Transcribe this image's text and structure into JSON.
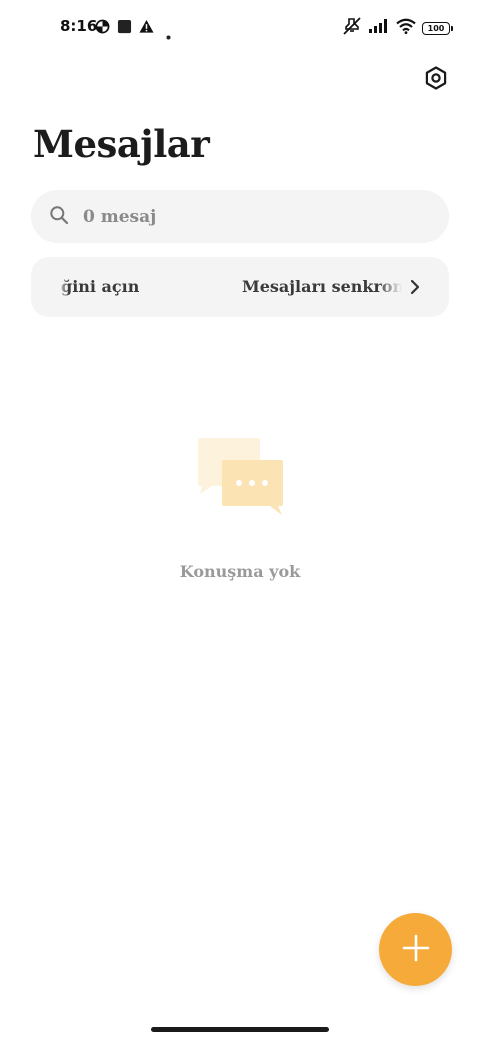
{
  "status_bar": {
    "time": "8:16",
    "battery": "100",
    "icons": [
      "data-saver-icon",
      "app-notification-icon",
      "warning-icon",
      "dot-icon",
      "mute-icon",
      "signal-icon",
      "wifi-icon",
      "battery-icon"
    ]
  },
  "header": {
    "title": "Mesajlar",
    "settings_icon": "settings-hexagon-icon"
  },
  "search": {
    "placeholder": "0 mesaj",
    "icon": "search-icon"
  },
  "sync_banner": {
    "text_fragment_start": "ğini açın",
    "text_fragment_end": "Mesajları senkron",
    "chevron_icon": "chevron-right-icon"
  },
  "empty_state": {
    "icon": "chat-bubbles-icon",
    "text": "Konuşma yok"
  },
  "fab": {
    "icon": "plus-icon"
  },
  "colors": {
    "accent": "#f6aa3a",
    "surface": "#f4f4f4",
    "illustration_back": "#fdf2dc",
    "illustration_front": "#fce3b4"
  }
}
